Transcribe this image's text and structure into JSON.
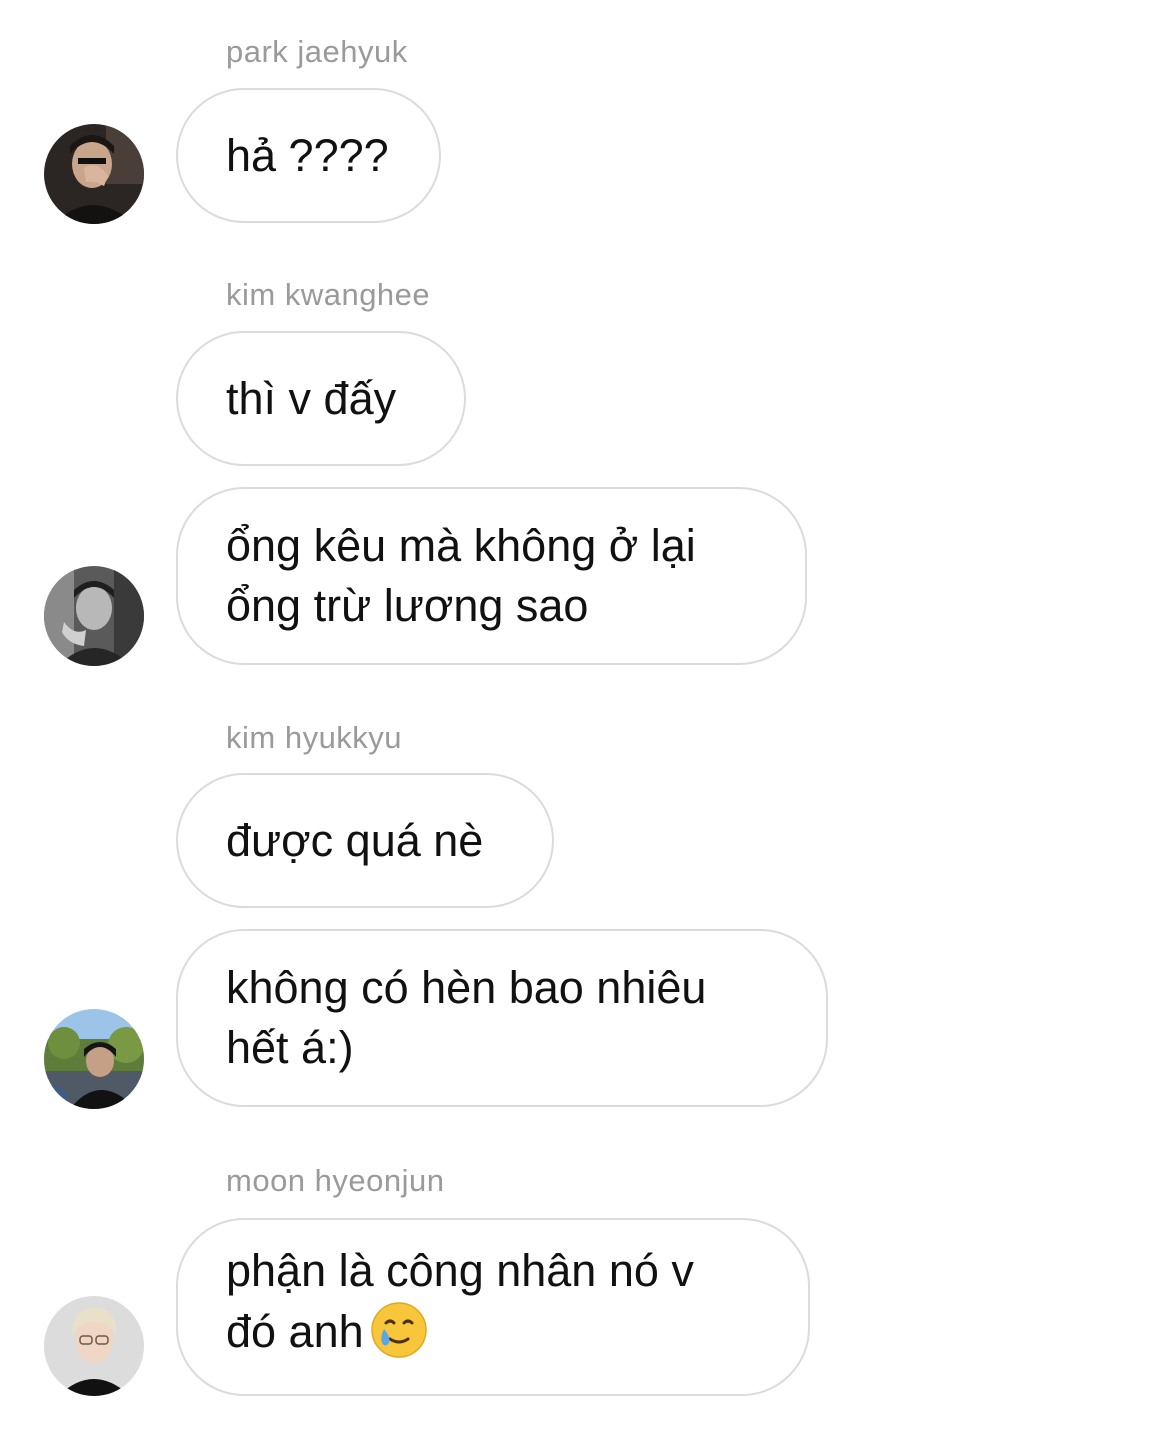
{
  "messages": [
    {
      "sender": "park jaehyuk",
      "bubbles": [
        "hả ????"
      ]
    },
    {
      "sender": "kim kwanghee",
      "bubbles": [
        "thì v đấy",
        "ổng kêu mà không ở lại\nổng trừ lương sao"
      ]
    },
    {
      "sender": "kim hyukkyu",
      "bubbles": [
        "được quá nè",
        "không có hèn bao nhiêu\nhết á:)"
      ]
    },
    {
      "sender": "moon hyeonjun",
      "bubbles": [
        "phận là công nhân nó v\nđó anh"
      ]
    }
  ],
  "emoji": "smiling-face-with-tear-icon",
  "colors": {
    "bubble_border": "#dbdbdb",
    "sender_name": "#9a9a9a",
    "text": "#111111",
    "background": "#ffffff"
  }
}
